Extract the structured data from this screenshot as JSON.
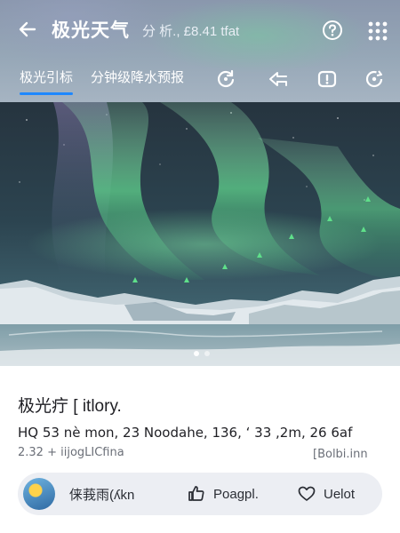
{
  "header": {
    "title": "极光天气",
    "subtitle": "分 析., £8.41 tfat",
    "tabs": [
      {
        "label": "极光引标",
        "active": true
      },
      {
        "label": "分钟级降水预报",
        "active": false
      }
    ]
  },
  "icons": {
    "back": "arrow-left-icon",
    "help": "help-icon",
    "grid": "grid-menu-icon",
    "tab_icons": [
      "refresh-icon",
      "forward-icon",
      "alert-icon",
      "reload-icon"
    ]
  },
  "carousel": {
    "pages": 2,
    "current": 1
  },
  "post": {
    "title": "极光疔 [ itlory.",
    "stats": "HQ  53 nè mon,  23 Noodahe,  136, ʻ 33 ,2m,  26 6af",
    "meta_left": "2.32 + iijogLICfina",
    "meta_right": "[Bolbi.inn",
    "author": "俫莪雨(ʎkn",
    "like_label": "Poagpl.",
    "favorite_label": "Uelot"
  },
  "colors": {
    "accent": "#1e88ff",
    "aurora_green": "#5fe08a"
  }
}
